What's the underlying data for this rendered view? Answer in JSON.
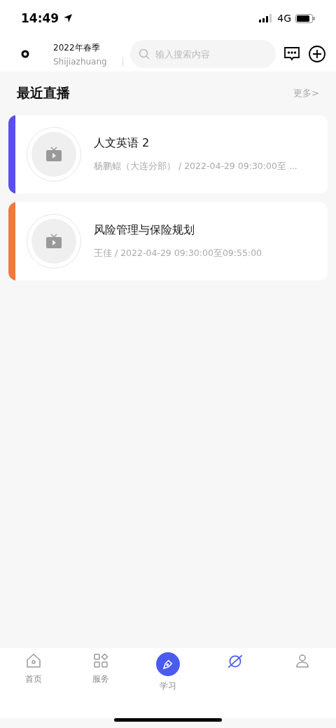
{
  "status_bar": {
    "time": "14:49",
    "network": "4G"
  },
  "header": {
    "term": "2022年春季",
    "city": "Shijiazhuang",
    "search": {
      "placeholder": "输入搜索内容"
    }
  },
  "section": {
    "title": "最近直播",
    "more": "更多>"
  },
  "lives": [
    {
      "title": "人文英语 2",
      "meta": "杨鹏鲲（大连分部） / 2022-04-29 09:30:00至 ...",
      "color": "#5b4ef0"
    },
    {
      "title": "风险管理与保险规划",
      "meta": "王佳 / 2022-04-29 09:30:00至09:55:00",
      "color": "#ee7a3c"
    }
  ],
  "tab_bar": [
    {
      "kind": "home",
      "label": "首页",
      "selected": false
    },
    {
      "kind": "grid",
      "label": "服务",
      "selected": false
    },
    {
      "kind": "pen",
      "label": "学习",
      "selected": false
    },
    {
      "kind": "planet",
      "selected": true
    },
    {
      "kind": "user",
      "selected": false
    }
  ]
}
